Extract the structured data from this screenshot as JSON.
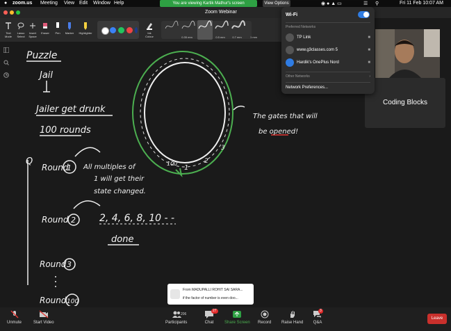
{
  "menubar": {
    "apple": "",
    "app": "zoom.us",
    "items": [
      "Meeting",
      "View",
      "Edit",
      "Window",
      "Help"
    ],
    "share_notice": "You are viewing Kartik Mathur's screen",
    "view_options": "View Options",
    "clock": "Fri 11 Feb  10:07 AM"
  },
  "window": {
    "title": "Zoom Webinar"
  },
  "annotate_toolbar": {
    "tools": [
      {
        "label1": "Text",
        "label2": "Mode"
      },
      {
        "label1": "Lasso",
        "label2": "Select"
      },
      {
        "label1": "Insert",
        "label2": "Space"
      },
      {
        "label1": "Eraser",
        "label2": ""
      },
      {
        "label1": "Pen",
        "label2": ""
      },
      {
        "label1": "Marker",
        "label2": ""
      },
      {
        "label1": "Highlighter",
        "label2": ""
      }
    ],
    "colors": [
      "#ffffff",
      "#3b82f6",
      "#22c55e",
      "#ef4444",
      "#1e3a8a"
    ],
    "ink_label1": "Ink",
    "ink_label2": "Colour",
    "strokes": [
      "0.35 mm",
      "0.35 mm",
      "0.5 mm",
      "0.7 mm",
      "1 mm"
    ]
  },
  "wifi_menu": {
    "title": "Wi-Fi",
    "enabled": true,
    "preferred_header": "Preferred Networks",
    "preferred": [
      "TP Link",
      "www.g3classes.com 5",
      "Hardik's OnePlus Nord"
    ],
    "other_label": "Other Networks",
    "prefs_label": "Network Preferences..."
  },
  "participant": {
    "name": "Coding Blocks"
  },
  "whiteboard": {
    "puzzle": "Puzzle",
    "jail": "Jail",
    "jailer": "Jailer get drunk",
    "rounds": "100 rounds",
    "q": "Q",
    "round1": "Round",
    "round1_num": "1",
    "round1_note1": "All multiples of",
    "round1_note2": "1 will get their",
    "round1_note3": "state changed.",
    "round2": "Round",
    "round2_num": "2",
    "round2_seq": "2, 4, 6, 8, 10 - -",
    "round2_done": "done",
    "round3": "Round",
    "round3_num": "3",
    "round100": "Round",
    "round100_num": "100",
    "gates_note1": "The gates that will",
    "gates_note2": "be opened!",
    "circle_labels": [
      "100",
      "1",
      "2",
      "3"
    ]
  },
  "chat_toast": {
    "from": "From MADUPALLI ROHIT SAI SARA...",
    "message": "if the factor of number is even doo..."
  },
  "bottom_bar": {
    "unmute": "Unmute",
    "start_video": "Start Video",
    "participants": "Participants",
    "participants_count": "206",
    "chat": "Chat",
    "chat_badge": "27",
    "share": "Share Screen",
    "record": "Record",
    "raise": "Raise Hand",
    "qa": "Q&A",
    "qa_badge": "3",
    "leave": "Leave"
  }
}
